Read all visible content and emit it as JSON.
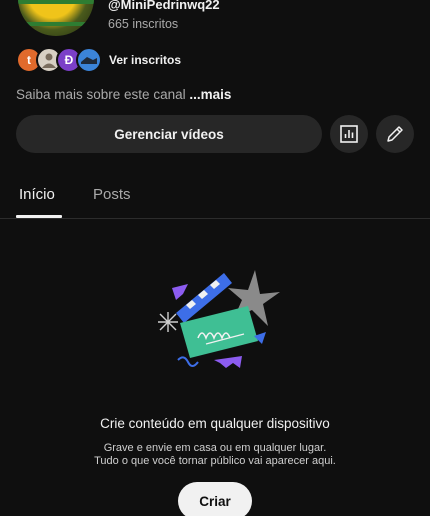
{
  "channel": {
    "handle": "@MiniPedrinwq22",
    "subscribers": "665 inscritos"
  },
  "subscribers_preview": {
    "avatars": [
      "t",
      "",
      "Đ",
      ""
    ],
    "link_label": "Ver inscritos"
  },
  "about": {
    "text": "Saiba mais sobre este canal",
    "more": "...mais"
  },
  "actions": {
    "manage_label": "Gerenciar vídeos",
    "analytics_icon": "analytics-icon",
    "edit_icon": "pencil-icon"
  },
  "tabs": [
    {
      "label": "Início",
      "selected": true
    },
    {
      "label": "Posts",
      "selected": false
    }
  ],
  "empty_state": {
    "title": "Crie conteúdo em qualquer dispositivo",
    "line1": "Grave e envie em casa ou em qualquer lugar.",
    "line2": "Tudo o que você tornar público vai aparecer aqui.",
    "button": "Criar"
  },
  "colors": {
    "background": "#0f0f0f",
    "button_bg": "#272727",
    "text_primary": "#f1f1f1",
    "text_secondary": "#aaaaaa",
    "illustration_green": "#3fbf94",
    "illustration_blue": "#3d6ee8",
    "illustration_purple": "#8c5cf0"
  }
}
